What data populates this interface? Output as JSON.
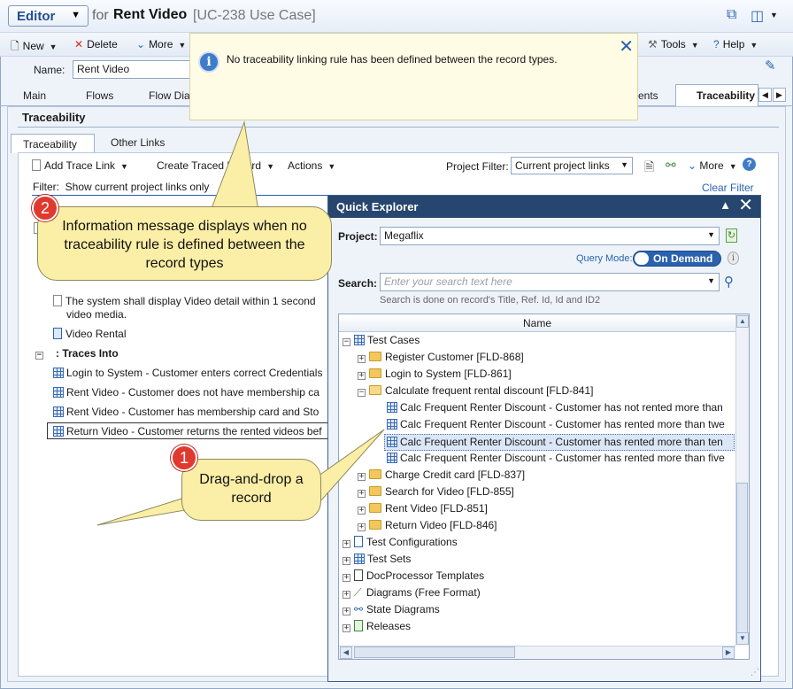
{
  "title": {
    "editor_label": "Editor",
    "for_label": "for",
    "record_name": "Rent Video",
    "record_id": "[UC-238 Use Case]"
  },
  "toolbar": {
    "new": "New",
    "delete": "Delete",
    "more": "More",
    "tools": "Tools",
    "help": "Help"
  },
  "name_field": {
    "label": "Name:",
    "value": "Rent Video"
  },
  "main_tabs": {
    "main": "Main",
    "flows": "Flows",
    "flow_diagram": "Flow Dia",
    "attachments_tail": "ents",
    "traceability": "Traceability"
  },
  "section": {
    "title": "Traceability",
    "subtab_traceability": "Traceability",
    "subtab_other_links": "Other Links"
  },
  "trace_toolbar": {
    "add_trace_link": "Add Trace Link",
    "create_traced_record": "Create Traced Record",
    "actions": "Actions",
    "project_filter_label": "Project Filter:",
    "project_filter_value": "Current project links",
    "more": "More"
  },
  "filter": {
    "label": "Filter:",
    "text": "Show current project links only",
    "clear": "Clear Filter"
  },
  "trace_list": {
    "item_requirement": "The system shall display Video detail within 1 second",
    "item_requirement_line2": "video media.",
    "item_video_rental": "Video Rental",
    "traces_into": ": Traces Into",
    "traces": [
      "Login to System - Customer enters correct Credentials",
      "Rent Video - Customer does not have membership ca",
      "Rent Video - Customer has membership card and Sto",
      "Return Video - Customer returns the rented videos bef"
    ]
  },
  "info_message": "No traceability linking rule has been defined between the record types.",
  "quick_explorer": {
    "title": "Quick Explorer",
    "project_label": "Project:",
    "project_value": "Megaflix",
    "query_mode_label": "Query Mode:",
    "query_mode_value": "On Demand",
    "search_label": "Search:",
    "search_placeholder": "Enter your search text here",
    "search_hint": "Search is done on record's Title, Ref. Id, Id and ID2",
    "column_name": "Name",
    "tree": {
      "test_cases": "Test Cases",
      "folders_top": [
        "Register Customer [FLD-868]",
        "Login to System [FLD-861]",
        "Calculate frequent rental discount [FLD-841]"
      ],
      "children": [
        "Calc Frequent Renter Discount - Customer has not rented more than",
        "Calc Frequent Renter Discount - Customer has rented more than twe",
        "Calc Frequent Renter Discount - Customer has rented more than ten",
        "Calc Frequent Renter Discount - Customer has rented more than five"
      ],
      "folders_bottom": [
        "Charge Credit card [FLD-837]",
        "Search for Video [FLD-855]",
        "Rent Video [FLD-851]",
        "Return Video [FLD-846]"
      ],
      "roots": [
        "Test Configurations",
        "Test Sets",
        "DocProcessor Templates",
        "Diagrams (Free Format)",
        "State Diagrams",
        "Releases"
      ]
    }
  },
  "callouts": {
    "one_number": "1",
    "one_text": "Drag-and-drop a record",
    "two_number": "2",
    "two_text": "Information message displays when no traceability rule is defined between the record types"
  }
}
